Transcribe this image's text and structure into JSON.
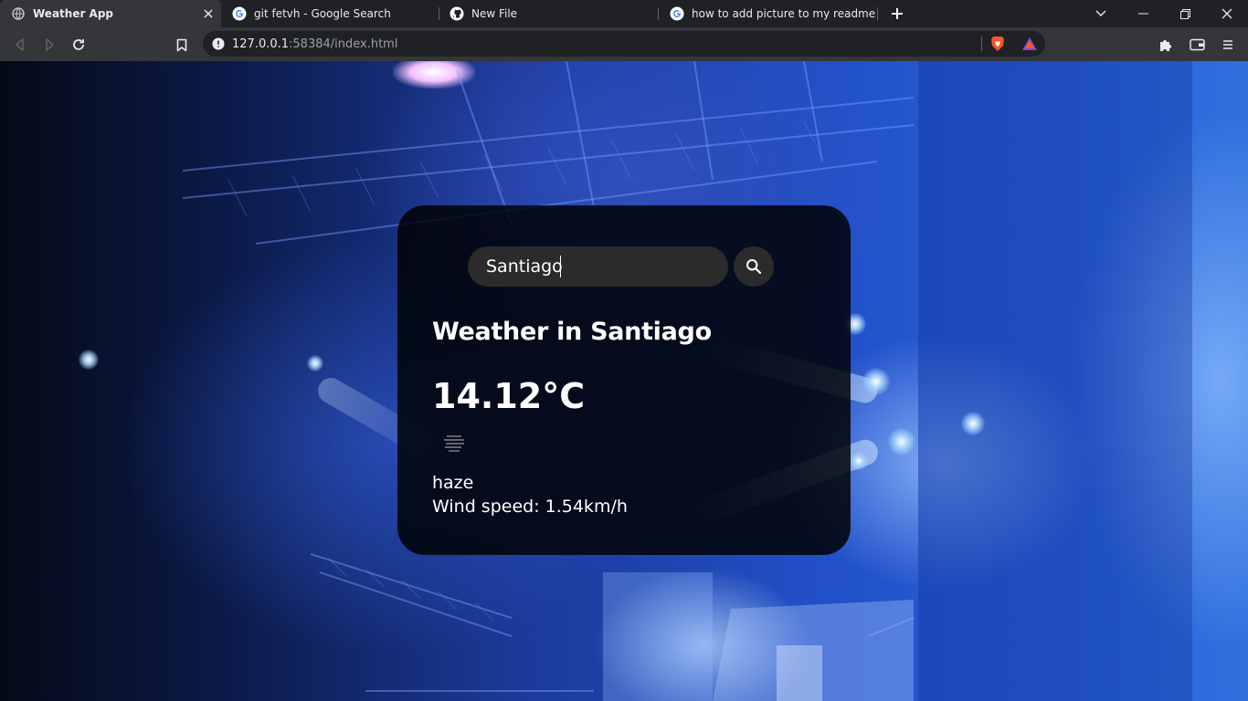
{
  "browser": {
    "tabs": [
      {
        "title": "Weather App",
        "icon": "globe-icon",
        "active": true
      },
      {
        "title": "git fetvh - Google Search",
        "icon": "google-icon",
        "active": false
      },
      {
        "title": "New File",
        "icon": "github-icon",
        "active": false
      },
      {
        "title": "how to add picture to my readme - Go",
        "icon": "google-icon",
        "active": false
      }
    ],
    "url": {
      "host": "127.0.0.1",
      "rest": ":58384/index.html"
    }
  },
  "weather": {
    "search": {
      "value": "Santiago",
      "placeholder": "Search"
    },
    "city_heading": "Weather in Santiago",
    "temperature": "14.12°C",
    "icon": "haze-icon",
    "description": "haze",
    "wind": "Wind speed: 1.54km/h"
  }
}
